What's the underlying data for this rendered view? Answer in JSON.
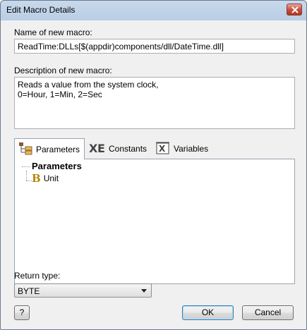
{
  "window": {
    "title": "Edit Macro Details"
  },
  "name": {
    "label": "Name of new macro:",
    "value": "ReadTime:DLLs[$(appdir)components/dll/DateTime.dll]"
  },
  "description": {
    "label": "Description of new macro:",
    "value": "Reads a value from the system clock,\n0=Hour, 1=Min, 2=Sec"
  },
  "tabs": [
    {
      "label": "Parameters",
      "icon": "parameters-icon",
      "active": true
    },
    {
      "label": "Constants",
      "icon": "constants-icon",
      "active": false
    },
    {
      "label": "Variables",
      "icon": "variables-icon",
      "active": false
    }
  ],
  "tree": {
    "root": "Parameters",
    "children": [
      {
        "type_icon": "B",
        "label": "Unit"
      }
    ]
  },
  "return_type": {
    "label": "Return type:",
    "value": "BYTE"
  },
  "buttons": {
    "help": "?",
    "ok": "OK",
    "cancel": "Cancel"
  },
  "colors": {
    "title_bar": "#b9cde4",
    "close_button": "#c7503d",
    "tree_type_icon": "#b8860b"
  }
}
